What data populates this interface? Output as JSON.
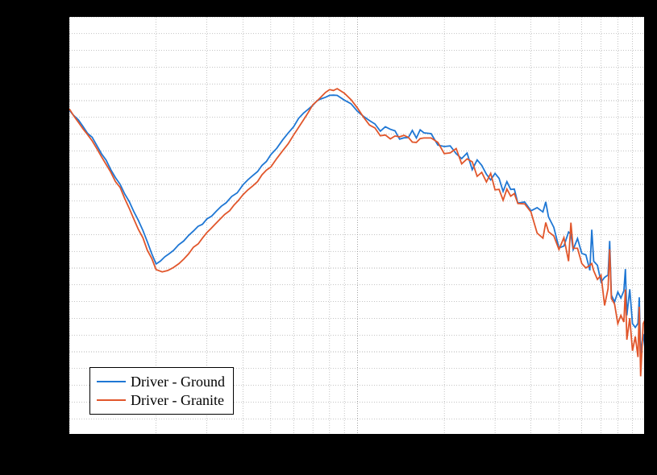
{
  "chart_data": {
    "type": "line",
    "x_scale": "log",
    "xlim": [
      1,
      100
    ],
    "ylim": [
      -3,
      2
    ],
    "x_ticks_major": [
      1,
      10,
      100
    ],
    "x_ticks_minor": [
      2,
      3,
      4,
      5,
      6,
      7,
      8,
      9,
      20,
      30,
      40,
      50,
      60,
      70,
      80,
      90
    ],
    "y_ticks_major": [
      -3,
      -2,
      -1,
      0,
      1,
      2
    ],
    "y_ticks_minor": [
      -2.8,
      -2.6,
      -2.4,
      -2.2,
      -1.8,
      -1.6,
      -1.4,
      -1.2,
      -0.8,
      -0.6,
      -0.4,
      -0.2,
      0.2,
      0.4,
      0.6,
      0.8,
      1.2,
      1.4,
      1.6,
      1.8
    ],
    "legend_position": "lower-left",
    "series": [
      {
        "name": "Driver - Ground",
        "color": "#1f77d4",
        "x": [
          1,
          1.2,
          1.5,
          1.8,
          2,
          2.3,
          2.7,
          3,
          3.5,
          4,
          4.5,
          5,
          5.5,
          6,
          6.5,
          7,
          7.5,
          8,
          8.5,
          9,
          9.5,
          10,
          11,
          12,
          13,
          14,
          15,
          16,
          17,
          18,
          19,
          20,
          22,
          24,
          25,
          26,
          28,
          30,
          32,
          34,
          35,
          36,
          38,
          40,
          42,
          44,
          45,
          46,
          48,
          50,
          52,
          54,
          55,
          56,
          58,
          60,
          62,
          64,
          65,
          66,
          68,
          70,
          72,
          74,
          75,
          76,
          78,
          80,
          82,
          84,
          85,
          86,
          88,
          90,
          92,
          94,
          95,
          96,
          98,
          100
        ],
        "y": [
          0.9,
          0.55,
          0.0,
          -0.55,
          -0.95,
          -0.78,
          -0.55,
          -0.42,
          -0.22,
          -0.02,
          0.16,
          0.34,
          0.52,
          0.7,
          0.86,
          0.96,
          1.02,
          1.06,
          1.05,
          1.0,
          0.95,
          0.88,
          0.76,
          0.68,
          0.62,
          0.58,
          0.58,
          0.6,
          0.58,
          0.54,
          0.52,
          0.5,
          0.42,
          0.32,
          0.26,
          0.22,
          0.12,
          0.04,
          -0.04,
          -0.1,
          0.02,
          -0.16,
          -0.26,
          -0.34,
          -0.4,
          -0.44,
          -0.32,
          -0.5,
          -0.56,
          -0.62,
          -0.66,
          -0.68,
          -0.5,
          -0.72,
          -0.78,
          -0.82,
          -0.88,
          -0.9,
          -0.7,
          -0.94,
          -1.0,
          -1.04,
          -1.08,
          -1.12,
          -0.8,
          -1.18,
          -1.24,
          -1.3,
          -1.36,
          -1.4,
          -1.0,
          -1.46,
          -1.34,
          -1.6,
          -1.68,
          -1.74,
          -1.3,
          -1.86,
          -1.94,
          -2.02
        ]
      },
      {
        "name": "Driver - Granite",
        "color": "#e1562b",
        "x": [
          1,
          1.2,
          1.5,
          1.8,
          2,
          2.1,
          2.4,
          2.8,
          3,
          3.2,
          3.6,
          4,
          4.5,
          5,
          5.5,
          6,
          6.5,
          7,
          7.5,
          8,
          8.5,
          9,
          9.5,
          10,
          11,
          12,
          13,
          14,
          15,
          16,
          17,
          18,
          19,
          20,
          22,
          24,
          25,
          26,
          28,
          30,
          32,
          34,
          35,
          36,
          38,
          40,
          42,
          44,
          45,
          46,
          48,
          50,
          52,
          54,
          55,
          56,
          58,
          60,
          62,
          64,
          65,
          66,
          68,
          70,
          72,
          74,
          75,
          76,
          78,
          80,
          82,
          84,
          85,
          86,
          88,
          90,
          92,
          94,
          95,
          96,
          98,
          100
        ],
        "y": [
          0.9,
          0.52,
          -0.05,
          -0.65,
          -1.02,
          -1.05,
          -0.96,
          -0.7,
          -0.58,
          -0.48,
          -0.3,
          -0.14,
          0.04,
          0.22,
          0.4,
          0.58,
          0.77,
          0.94,
          1.05,
          1.12,
          1.14,
          1.08,
          1.0,
          0.9,
          0.72,
          0.62,
          0.57,
          0.56,
          0.56,
          0.55,
          0.53,
          0.51,
          0.48,
          0.44,
          0.38,
          0.28,
          0.22,
          0.18,
          0.08,
          0.0,
          -0.08,
          -0.16,
          -0.06,
          -0.22,
          -0.32,
          -0.4,
          -0.46,
          -0.52,
          -0.34,
          -0.56,
          -0.64,
          -0.7,
          -0.76,
          -0.8,
          -0.6,
          -0.84,
          -0.9,
          -0.96,
          -1.02,
          -1.06,
          -0.8,
          -1.1,
          -1.16,
          -1.22,
          -1.28,
          -1.32,
          -0.9,
          -1.4,
          -1.46,
          -1.54,
          -1.6,
          -1.66,
          -1.1,
          -1.74,
          -1.56,
          -1.88,
          -1.96,
          -2.02,
          -1.4,
          -2.14,
          -1.8,
          -1.6
        ]
      }
    ]
  },
  "legend": {
    "items": [
      {
        "label": "Driver - Ground",
        "color": "#1f77d4"
      },
      {
        "label": "Driver - Granite",
        "color": "#e1562b"
      }
    ]
  }
}
